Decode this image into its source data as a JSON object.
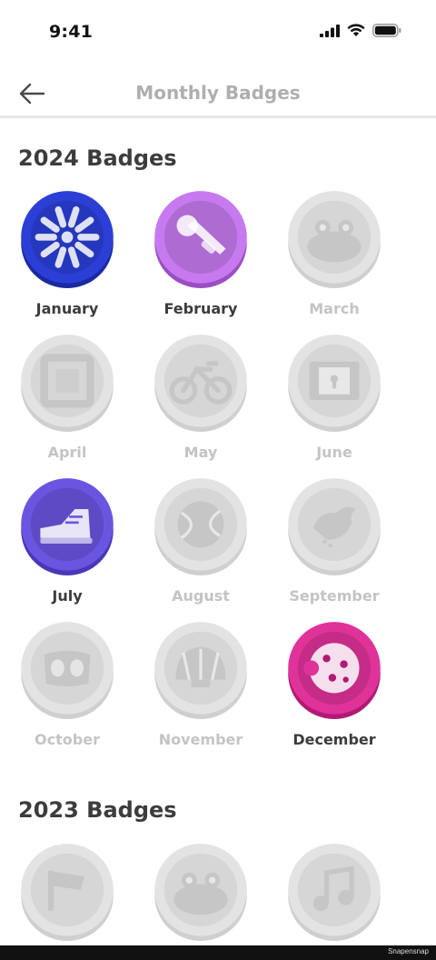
{
  "status": {
    "time": "9:41"
  },
  "header": {
    "title": "Monthly Badges"
  },
  "sections": [
    {
      "title": "2024 Badges",
      "badges": [
        {
          "label": "January",
          "state": "earned",
          "icon": "sparkle-icon",
          "color": "#2b3fd6",
          "dark": "#1a2aa0"
        },
        {
          "label": "February",
          "state": "earned",
          "icon": "trumpet-icon",
          "color": "#c77af0",
          "dark": "#9b4ec4"
        },
        {
          "label": "March",
          "state": "locked",
          "icon": "frog-icon"
        },
        {
          "label": "April",
          "state": "locked",
          "icon": "picture-frame-icon"
        },
        {
          "label": "May",
          "state": "locked",
          "icon": "bicycle-icon"
        },
        {
          "label": "June",
          "state": "locked",
          "icon": "treasure-door-icon"
        },
        {
          "label": "July",
          "state": "earned",
          "icon": "sneaker-icon",
          "color": "#6a55e0",
          "dark": "#4a36b8"
        },
        {
          "label": "August",
          "state": "locked",
          "icon": "tennis-ball-icon"
        },
        {
          "label": "September",
          "state": "locked",
          "icon": "bird-icon"
        },
        {
          "label": "October",
          "state": "locked",
          "icon": "owl-mask-icon"
        },
        {
          "label": "November",
          "state": "locked",
          "icon": "seashell-icon"
        },
        {
          "label": "December",
          "state": "earned",
          "icon": "cookie-icon",
          "color": "#e0339a",
          "dark": "#b11a74"
        }
      ]
    },
    {
      "title": "2023 Badges",
      "badges": [
        {
          "label": "",
          "state": "locked",
          "icon": "flag-icon"
        },
        {
          "label": "",
          "state": "locked",
          "icon": "frog-icon"
        },
        {
          "label": "",
          "state": "locked",
          "icon": "music-note-icon"
        }
      ]
    }
  ],
  "footer": {
    "watermark": "Snapensnap"
  }
}
